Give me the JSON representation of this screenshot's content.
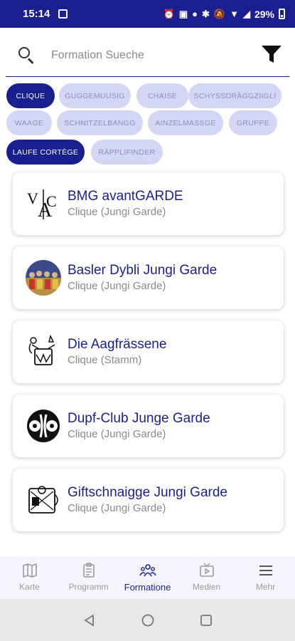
{
  "status_bar": {
    "time": "15:14",
    "battery_text": "29%"
  },
  "search": {
    "placeholder": "Formation Sueche",
    "value": ""
  },
  "chips": [
    {
      "label": "CLIQUE",
      "active": true
    },
    {
      "label": "GUGGEMUUSIG",
      "active": false
    },
    {
      "label": "CHAISE",
      "active": false
    },
    {
      "label": "SCHYSSDRÄGGZIIGLI",
      "active": false
    },
    {
      "label": "WAAGE",
      "active": false
    },
    {
      "label": "SCHNITZELBANGG",
      "active": false
    },
    {
      "label": "AINZELMASSGE",
      "active": false
    },
    {
      "label": "GRUPPE",
      "active": false
    },
    {
      "label": "LAUFE CORTÈGE",
      "active": true
    },
    {
      "label": "RÄPPLIFINDER",
      "active": false
    }
  ],
  "formations": [
    {
      "name": "BMG avantGARDE",
      "type": "Clique (Jungi Garde)",
      "icon": "vac-logo-icon"
    },
    {
      "name": "Basler Dybli Jungi Garde",
      "type": "Clique (Jungi Garde)",
      "icon": "group-photo-icon"
    },
    {
      "name": "Die Aagfrässene",
      "type": "Clique (Stamm)",
      "icon": "drummer-logo-icon"
    },
    {
      "name": "Dupf-Club Junge Garde",
      "type": "Clique (Jungi Garde)",
      "icon": "dots-logo-icon"
    },
    {
      "name": "Giftschnaigge Jungi Garde",
      "type": "Clique (Jungi Garde)",
      "icon": "drum-logo-icon"
    }
  ],
  "nav": [
    {
      "label": "Karte",
      "icon": "map-icon",
      "active": false
    },
    {
      "label": "Programm",
      "icon": "clipboard-icon",
      "active": false
    },
    {
      "label": "Formatione",
      "icon": "people-icon",
      "active": true
    },
    {
      "label": "Medien",
      "icon": "tv-icon",
      "active": false
    },
    {
      "label": "Mehr",
      "icon": "menu-icon",
      "active": false
    }
  ],
  "colors": {
    "primary": "#1a1f8f",
    "chip_inactive_bg": "#d3d6f5",
    "chip_inactive_text": "#8d90b8"
  }
}
